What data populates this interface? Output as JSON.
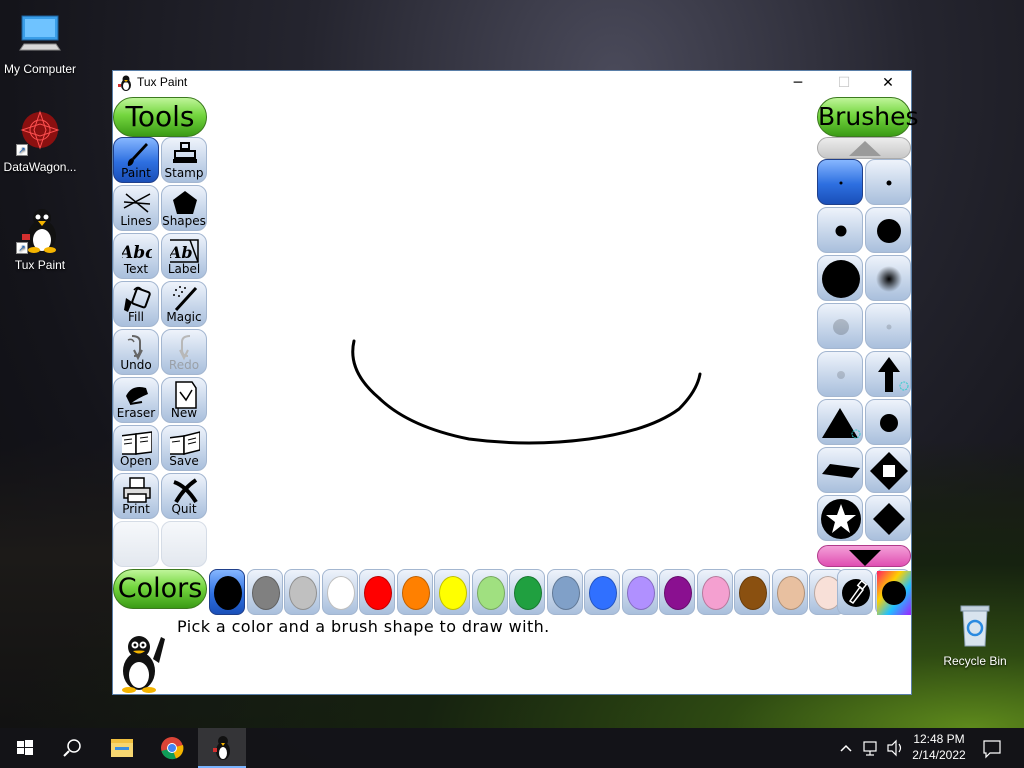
{
  "desktop": {
    "icons": [
      {
        "label": "My Computer",
        "icon": "computer-icon"
      },
      {
        "label": "DataWagon...",
        "icon": "datawagon-icon"
      },
      {
        "label": "Tux Paint",
        "icon": "tux-paint-icon"
      },
      {
        "label": "Recycle Bin",
        "icon": "recycle-bin-icon"
      }
    ]
  },
  "window": {
    "title": "Tux Paint",
    "controls": {
      "minimize": "─",
      "maximize": "☐",
      "close": "✕"
    }
  },
  "tools": {
    "header": "Tools",
    "selected": "Paint",
    "items": [
      {
        "label": "Paint",
        "icon": "paintbrush-icon",
        "enabled": true
      },
      {
        "label": "Stamp",
        "icon": "stamp-icon",
        "enabled": true
      },
      {
        "label": "Lines",
        "icon": "lines-icon",
        "enabled": true
      },
      {
        "label": "Shapes",
        "icon": "pentagon-icon",
        "enabled": true
      },
      {
        "label": "Text",
        "icon": "text-abc-icon",
        "enabled": true
      },
      {
        "label": "Label",
        "icon": "label-abc-icon",
        "enabled": true
      },
      {
        "label": "Fill",
        "icon": "paint-bucket-icon",
        "enabled": true
      },
      {
        "label": "Magic",
        "icon": "magic-wand-icon",
        "enabled": true
      },
      {
        "label": "Undo",
        "icon": "undo-icon",
        "enabled": true
      },
      {
        "label": "Redo",
        "icon": "redo-icon",
        "enabled": false
      },
      {
        "label": "Eraser",
        "icon": "eraser-icon",
        "enabled": true
      },
      {
        "label": "New",
        "icon": "new-page-icon",
        "enabled": true
      },
      {
        "label": "Open",
        "icon": "open-book-icon",
        "enabled": true
      },
      {
        "label": "Save",
        "icon": "save-book-icon",
        "enabled": true
      },
      {
        "label": "Print",
        "icon": "printer-icon",
        "enabled": true
      },
      {
        "label": "Quit",
        "icon": "quit-x-icon",
        "enabled": true
      }
    ]
  },
  "brushes": {
    "header": "Brushes",
    "items": [
      {
        "icon": "tiny-dot-brush-icon",
        "selected": true
      },
      {
        "icon": "small-dot-brush-icon"
      },
      {
        "icon": "medium-dot-brush-icon"
      },
      {
        "icon": "large-dot-brush-icon"
      },
      {
        "icon": "xlarge-dot-brush-icon"
      },
      {
        "icon": "fuzzy-dot-brush-icon"
      },
      {
        "icon": "faint-large-dot-brush-icon"
      },
      {
        "icon": "faint-small-dot-brush-icon"
      },
      {
        "icon": "faint-tiny-dot-brush-icon"
      },
      {
        "icon": "arrow-up-brush-icon"
      },
      {
        "icon": "triangle-brush-icon"
      },
      {
        "icon": "round-brush-icon"
      },
      {
        "icon": "diamond-flat-brush-icon"
      },
      {
        "icon": "diamond-square-brush-icon"
      },
      {
        "icon": "star-brush-icon"
      },
      {
        "icon": "diamond-brush-icon"
      }
    ]
  },
  "colors": {
    "header": "Colors",
    "selected": 0,
    "swatches": [
      "#000000",
      "#808080",
      "#c0c0c0",
      "#ffffff",
      "#ff0000",
      "#ff8000",
      "#ffff00",
      "#a0e080",
      "#20a040",
      "#80a0c8",
      "#3070ff",
      "#b090ff",
      "#8a1090",
      "#f4a0d0",
      "#8a5010",
      "#e8c0a0",
      "#f8e0d8"
    ],
    "extra": [
      {
        "icon": "color-picker-dropper-icon"
      },
      {
        "icon": "rainbow-color-wheel-icon"
      }
    ]
  },
  "status_message": "Pick a color and a brush shape to draw with.",
  "taskbar": {
    "items": [
      {
        "icon": "windows-start-icon"
      },
      {
        "icon": "search-icon"
      },
      {
        "icon": "file-explorer-icon"
      },
      {
        "icon": "chrome-icon"
      },
      {
        "icon": "tux-paint-icon",
        "active": true
      }
    ],
    "tray": {
      "time": "12:48 PM",
      "date": "2/14/2022",
      "icons": [
        "chevron-up-icon",
        "network-icon",
        "volume-icon",
        "notification-icon"
      ]
    }
  }
}
